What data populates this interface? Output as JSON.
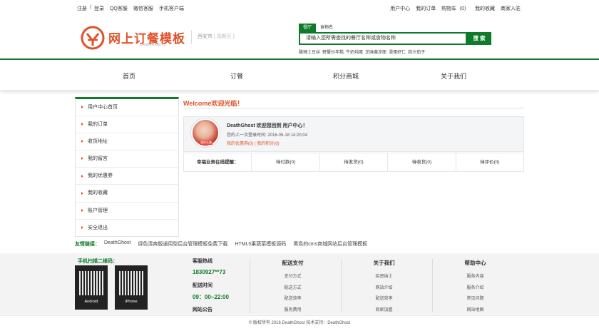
{
  "topbar": {
    "left": [
      "注册",
      "/",
      "登录",
      "QQ客服",
      "微信客服",
      "手机客户端"
    ],
    "right": [
      "用户中心",
      "我的订单",
      "购物车（0）",
      "我的收藏",
      "商家入驻"
    ]
  },
  "header": {
    "brand": "网上订餐模板",
    "brand_sub": "DeathGhost.cn",
    "city": "西安市",
    "city_region": "[ 高新区 ]",
    "tabs": [
      "餐厅",
      "食物名"
    ],
    "search_placeholder": "请输入您所需查找的餐厅名称或食物名称",
    "search_button": "搜 索",
    "hot": [
      "酸辣土豆丝",
      "螃蟹炒年糕",
      "牛奶炖蛋",
      "芝麻酱凉面",
      "滑蛋虾仁",
      "蒜汁茄子"
    ]
  },
  "nav": [
    "首页",
    "订餐",
    "积分商城",
    "关于我们"
  ],
  "sidebar": [
    "用户中心首页",
    "我的订单",
    "收货地址",
    "我的留言",
    "我的优惠券",
    "我的收藏",
    "账户管理",
    "安全退出"
  ],
  "main": {
    "welcome": "Welcome欢迎光临！",
    "user_line": "DeathGhost 欢迎您回到 用户中心！",
    "last_login": "您的上一次登录时间: 2016-05-18 14:20:04",
    "coupon": "我的优惠券(0) | 我的积分(0)",
    "avatar_tag": "我的头像",
    "stats": [
      "幸福业务在线提醒：",
      "待付款(0)",
      "待发货(0)",
      "待收货(0)",
      "待评价(0)"
    ]
  },
  "links": {
    "label": "友情链接：",
    "items": [
      "DeathGhost",
      "绿色清爽版通用型后台管理模板免费下载",
      "HTML5果蔬菜模板源码",
      "黑色的cms商城网站后台管理模板"
    ]
  },
  "footer": {
    "qr_title": "手机扫描二维码：",
    "qr": [
      "Android",
      "iPhone"
    ],
    "hotline_label": "客服热线",
    "hotline": "1830927**73",
    "time_label": "配送时间",
    "time": "09：00~22:00",
    "notice": "网站公告",
    "cols": [
      {
        "title": "配送支付",
        "items": [
          "支付方式",
          "配送方式",
          "配送效率",
          "服务费用"
        ]
      },
      {
        "title": "关于我们",
        "items": [
          "招贤纳士",
          "网站介绍",
          "配送效率",
          "商家加盟"
        ]
      },
      {
        "title": "帮助中心",
        "items": [
          "服务内容",
          "服务介绍",
          "常见问题",
          "网站地图"
        ]
      }
    ],
    "copyright": "© 版权所有 2016 DeathGhost 技术支持：DeathGhost"
  },
  "colors": {
    "accent": "#107a2b",
    "brand": "#e1512a"
  }
}
